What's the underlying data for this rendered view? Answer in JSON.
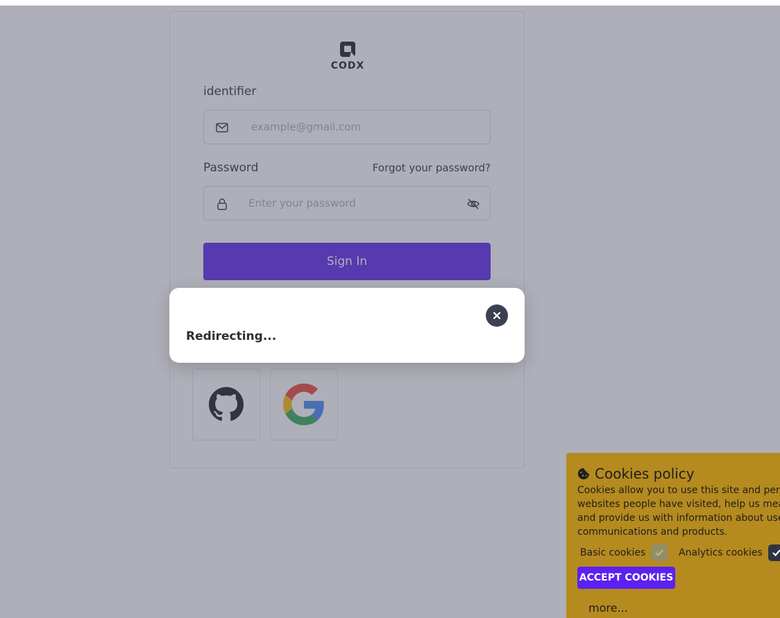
{
  "brand": {
    "logo_text": "CODX"
  },
  "login": {
    "identifier_label": "identifier",
    "identifier_placeholder": "example@gmail.com",
    "password_label": "Password",
    "forgot_link": "Forgot your password?",
    "password_placeholder": "Enter your password",
    "signin_label": "Sign In"
  },
  "social": [
    {
      "name": "github",
      "icon": "github-icon"
    },
    {
      "name": "google",
      "icon": "google-icon"
    }
  ],
  "toast": {
    "message": "Redirecting..."
  },
  "cookies": {
    "title": "Cookies policy",
    "body_lines": [
      "Cookies allow you to use this site and person",
      "websites people have visited, help us measur",
      "and provide us with information about user b",
      "communications and products."
    ],
    "basic_label": "Basic cookies",
    "analytics_label": "Analytics cookies",
    "accept_label": "ACCEPT COOKIES",
    "more_label": "more..."
  },
  "colors": {
    "primary": "#5b21f0",
    "overlay": "#8d8f9b",
    "cookie_bg": "#b58a1e",
    "toast_close_bg": "#3b4150"
  }
}
